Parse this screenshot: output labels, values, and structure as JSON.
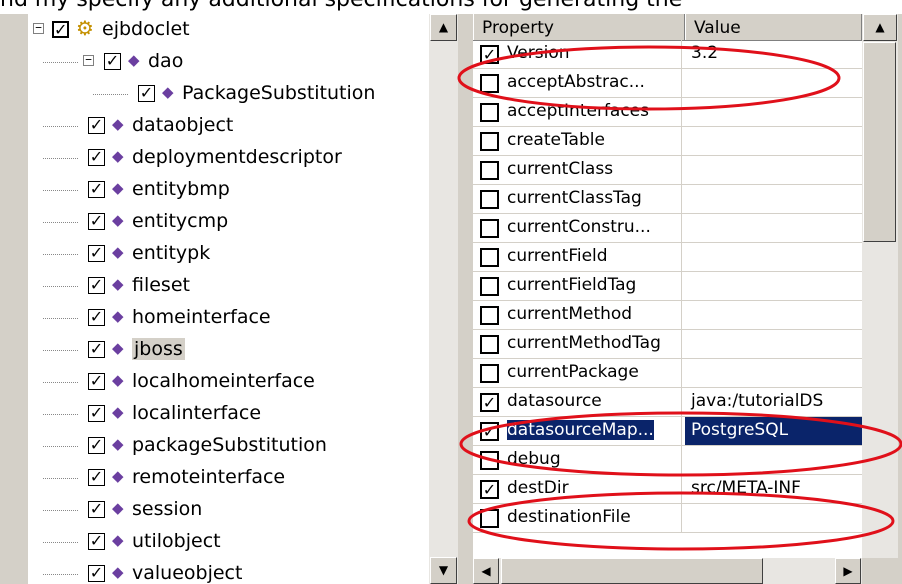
{
  "header_text": "nd my specify any additional specifications for generating the",
  "tree": {
    "root": {
      "label": "ejbdoclet",
      "checked": true,
      "expanded": true,
      "icon": "gear-icon"
    },
    "items": [
      {
        "label": "dao",
        "checked": true,
        "expanded": true,
        "icon": "element-icon"
      },
      {
        "label": "PackageSubstitution",
        "checked": true,
        "icon": "element-icon"
      },
      {
        "label": "dataobject",
        "checked": true,
        "icon": "element-icon"
      },
      {
        "label": "deploymentdescriptor",
        "checked": true,
        "icon": "element-icon"
      },
      {
        "label": "entitybmp",
        "checked": true,
        "icon": "element-icon"
      },
      {
        "label": "entitycmp",
        "checked": true,
        "icon": "element-icon"
      },
      {
        "label": "entitypk",
        "checked": true,
        "icon": "element-icon"
      },
      {
        "label": "fileset",
        "checked": true,
        "icon": "element-icon"
      },
      {
        "label": "homeinterface",
        "checked": true,
        "icon": "element-icon"
      },
      {
        "label": "jboss",
        "checked": true,
        "icon": "element-icon",
        "selected": true
      },
      {
        "label": "localhomeinterface",
        "checked": true,
        "icon": "element-icon"
      },
      {
        "label": "localinterface",
        "checked": true,
        "icon": "element-icon"
      },
      {
        "label": "packageSubstitution",
        "checked": true,
        "icon": "element-icon"
      },
      {
        "label": "remoteinterface",
        "checked": true,
        "icon": "element-icon"
      },
      {
        "label": "session",
        "checked": true,
        "icon": "element-icon"
      },
      {
        "label": "utilobject",
        "checked": true,
        "icon": "element-icon"
      },
      {
        "label": "valueobject",
        "checked": true,
        "icon": "element-icon"
      }
    ]
  },
  "properties": {
    "columns": {
      "property": "Property",
      "value": "Value"
    },
    "rows": [
      {
        "name": "Version",
        "checked": true,
        "value": "3.2"
      },
      {
        "name": "acceptAbstrac...",
        "checked": false,
        "value": ""
      },
      {
        "name": "acceptInterfaces",
        "checked": false,
        "value": ""
      },
      {
        "name": "createTable",
        "checked": false,
        "value": ""
      },
      {
        "name": "currentClass",
        "checked": false,
        "value": ""
      },
      {
        "name": "currentClassTag",
        "checked": false,
        "value": ""
      },
      {
        "name": "currentConstru...",
        "checked": false,
        "value": ""
      },
      {
        "name": "currentField",
        "checked": false,
        "value": ""
      },
      {
        "name": "currentFieldTag",
        "checked": false,
        "value": ""
      },
      {
        "name": "currentMethod",
        "checked": false,
        "value": ""
      },
      {
        "name": "currentMethodTag",
        "checked": false,
        "value": ""
      },
      {
        "name": "currentPackage",
        "checked": false,
        "value": ""
      },
      {
        "name": "datasource",
        "checked": true,
        "value": "java:/tutorialDS"
      },
      {
        "name": "datasourceMap...",
        "checked": true,
        "value": "PostgreSQL",
        "selected": true
      },
      {
        "name": "debug",
        "checked": false,
        "value": ""
      },
      {
        "name": "destDir",
        "checked": true,
        "value": "src/META-INF"
      },
      {
        "name": "destinationFile",
        "checked": false,
        "value": ""
      }
    ]
  },
  "annotation_color": "#e0101a",
  "selection_color": "#0a246a"
}
